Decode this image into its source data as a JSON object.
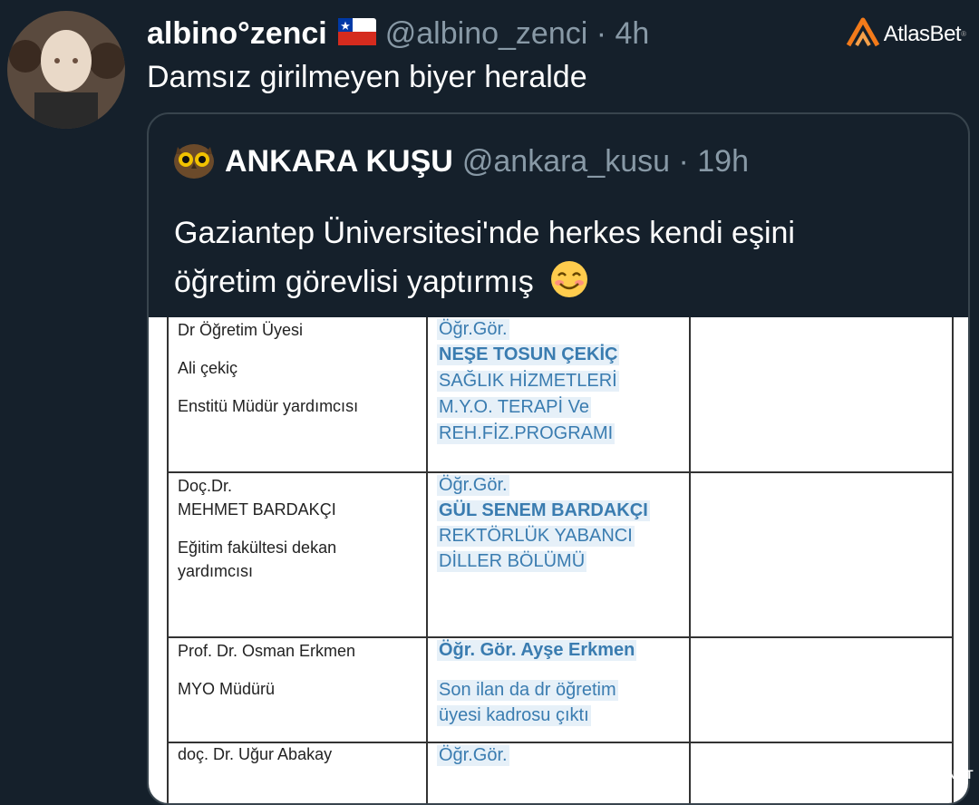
{
  "tweet": {
    "display_name": "albino°zenci",
    "handle": "@albino_zenci · 4h",
    "text": "Damsız girilmeyen biyer heralde"
  },
  "brand": {
    "name": "AtlasBet",
    "sup": "®"
  },
  "quoted": {
    "display_name": "ANKARA KUŞU",
    "handle": "@ankara_kusu · 19h",
    "text_line1": "Gaziantep Üniversitesi'nde herkes kendi eşini",
    "text_line2": "öğretim görevlisi yaptırmış"
  },
  "document_rows": [
    {
      "left": [
        "Dr Öğretim Üyesi",
        "Ali çekiç",
        "Enstitü Müdür yardımcısı"
      ],
      "middle": [
        "Öğr.Gör.",
        "NEŞE TOSUN ÇEKİÇ",
        "SAĞLIK HİZMETLERİ",
        "M.Y.O. TERAPİ Ve",
        "REH.FİZ.PROGRAMI"
      ]
    },
    {
      "left": [
        "Doç.Dr.",
        "MEHMET BARDAKÇI",
        "Eğitim fakültesi dekan",
        "yardımcısı"
      ],
      "middle": [
        "Öğr.Gör.",
        "GÜL SENEM BARDAKÇI",
        "REKTÖRLÜK YABANCI",
        "DİLLER BÖLÜMÜ"
      ]
    },
    {
      "left": [
        "Prof. Dr. Osman Erkmen",
        "MYO Müdürü"
      ],
      "middle": [
        "Öğr. Gör. Ayşe Erkmen",
        "Son ilan da dr öğretim",
        "üyesi kadrosu çıktı"
      ]
    },
    {
      "left": [
        "doç. Dr. Uğur Abakay"
      ],
      "middle": [
        "Öğr.Gör."
      ]
    }
  ],
  "watermark": "GULDUM.NET",
  "icons": [
    "avatar-photo",
    "chile-flag-icon",
    "atlasbet-logo-icon",
    "owl-avatar-icon",
    "smiling-face-emoji"
  ]
}
